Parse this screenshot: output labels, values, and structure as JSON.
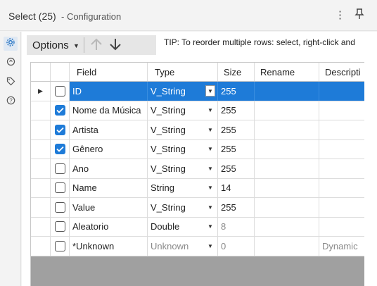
{
  "title": {
    "name": "Select (25)",
    "subtitle": "- Configuration"
  },
  "toolbar": {
    "options_label": "Options",
    "tip": "TIP: To reorder multiple rows: select, right-click and"
  },
  "grid": {
    "columns": [
      "Field",
      "Type",
      "Size",
      "Rename",
      "Descripti"
    ],
    "rows": [
      {
        "checked": false,
        "field": "ID",
        "type": "V_String",
        "size": "255",
        "rename": "",
        "description": "",
        "selected": true
      },
      {
        "checked": true,
        "field": "Nome da Música",
        "type": "V_String",
        "size": "255",
        "rename": "",
        "description": ""
      },
      {
        "checked": true,
        "field": "Artista",
        "type": "V_String",
        "size": "255",
        "rename": "",
        "description": ""
      },
      {
        "checked": true,
        "field": "Gênero",
        "type": "V_String",
        "size": "255",
        "rename": "",
        "description": ""
      },
      {
        "checked": false,
        "field": "Ano",
        "type": "V_String",
        "size": "255",
        "rename": "",
        "description": ""
      },
      {
        "checked": false,
        "field": "Name",
        "type": "String",
        "size": "14",
        "rename": "",
        "description": ""
      },
      {
        "checked": false,
        "field": "Value",
        "type": "V_String",
        "size": "255",
        "rename": "",
        "description": ""
      },
      {
        "checked": false,
        "field": "Aleatorio",
        "type": "Double",
        "size": "8",
        "rename": "",
        "description": ""
      },
      {
        "checked": false,
        "field": "*Unknown",
        "type": "Unknown",
        "size": "0",
        "rename": "",
        "description": "Dynamic"
      }
    ]
  },
  "icons": {
    "rail": [
      "gear-icon",
      "refresh-icon",
      "tag-icon",
      "help-icon"
    ],
    "title": [
      "more-options-icon",
      "pin-icon"
    ],
    "toolbar": [
      "arrow-up-icon",
      "arrow-down-icon"
    ]
  },
  "colors": {
    "accent": "#1e7bd8",
    "selection": "#1e7bd8"
  }
}
